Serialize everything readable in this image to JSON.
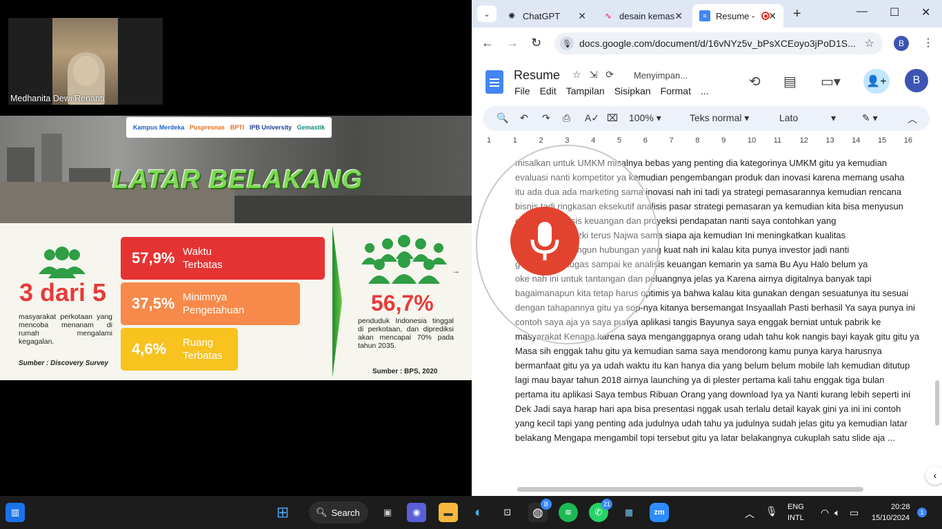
{
  "video": {
    "participant_name": "Medhanita Dewi Renanti"
  },
  "slide": {
    "logos": [
      "Kampus Merdeka",
      "Puspresnas",
      "BPTI",
      "IPB University",
      "Gemastik"
    ],
    "title": "LATAR BELAKANG",
    "left_stat": "3 dari 5",
    "left_desc": "masyarakat perkotaan yang mencoba menanam di rumah mengalami kegagalan.",
    "left_source": "Sumber : Discovery Survey",
    "bars": [
      {
        "pct": "57,9%",
        "label": "Waktu Terbatas"
      },
      {
        "pct": "37,5%",
        "label": "Minimnya Pengetahuan"
      },
      {
        "pct": "4,6%",
        "label": "Ruang Terbatas"
      }
    ],
    "right_stat": "56,7%",
    "right_desc": "penduduk Indonesia tinggal di perkotaan, dan diprediksi akan mencapai 70% pada tahun 2035.",
    "right_source": "Sumber : BPS, 2020",
    "colors": {
      "red": "#e53333",
      "orange": "#f78a4a",
      "yellow": "#f8c21f",
      "green": "#2f9e44"
    }
  },
  "browser": {
    "tabs": [
      {
        "title": "ChatGPT",
        "icon": "chatgpt-icon"
      },
      {
        "title": "desain kemas",
        "icon": "chart-icon"
      },
      {
        "title": "Resume -",
        "icon": "docs-icon"
      }
    ],
    "url": "docs.google.com/document/d/16vNYz5v_bPsXCEoyo3jPoD1S...",
    "profile_initial": "B"
  },
  "docs": {
    "title": "Resume",
    "status": "Menyimpan...",
    "menu": [
      "File",
      "Edit",
      "Tampilan",
      "Sisipkan",
      "Format",
      "..."
    ],
    "account_initial": "B",
    "toolbar": {
      "zoom": "100%",
      "style": "Teks normal",
      "font": "Lato"
    },
    "ruler": [
      "1",
      "1",
      "2",
      "3",
      "4",
      "5",
      "6",
      "7",
      "8",
      "9",
      "10",
      "11",
      "12",
      "13",
      "14",
      "15",
      "16"
    ],
    "lines": [
      "misalkan untuk UMKM misalnya bebas yang penting dia kategorinya UMKM gitu ya kemudian",
      "evaluasi nanti kompetitor ya kemudian pengembangan produk dan inovasi karena memang usaha",
      "itu ada dua ada marketing sama inovasi nah ini tadi ya strategi pemasarannya kemudian rencana",
      "bisnis tadi ringkasan eksekutif analisis pasar strategi pemasaran ya kemudian kita bisa menyusun",
      "e                          erta ini analisis keuangan dan proyeksi pendapatan nanti saya contohkan yang",
      "                         ya Ada siapa Rizki terus Najwa sama siapa aja kemudian Ini meningkatkan kualitas",
      "                          a sama Membangun hubungan yang kuat nah ini kalau kita punya investor jadi nanti",
      "g                         dah belum tugas sampai ke analisis keuangan kemarin ya sama Bu Ayu Halo belum ya",
      "oke nah ini untuk tantangan dan peluangnya jelas ya Karena airnya digitalnya banyak tapi",
      "bagaimanapun kita tetap harus optimis ya bahwa kalau kita gunakan dengan sesuatunya itu sesuai",
      "dengan tahapannya gitu ya sop-nya kitanya bersemangat Insyaallah Pasti berhasil Ya saya punya ini",
      "contoh saya aja ya saya punya aplikasi tangis Bayunya saya enggak berniat untuk pabrik ke",
      "masyarakat Kenapa karena saya menganggapnya orang udah tahu kok nangis bayi kayak gitu gitu ya",
      "Masa sih enggak tahu gitu ya kemudian sama saya mendorong kamu punya karya harusnya",
      "bermanfaat gitu ya ya udah waktu itu kan hanya dia yang belum belum mobile lah kemudian ditutup",
      "lagi mau bayar tahun 2018 airnya launching ya di plester pertama kali tahu enggak tiga bulan",
      "pertama itu aplikasi Saya tembus Ribuan Orang yang download Iya ya Nanti kurang lebih seperti ini",
      "Dek Jadi saya harap hari apa bisa presentasi nggak usah terlalu detail kayak gini ya ini ini contoh",
      "yang kecil tapi yang penting ada judulnya udah tahu ya judulnya sudah jelas gitu ya kemudian latar",
      "belakang Mengapa mengambil topi tersebut gitu ya latar belakangnya cukuplah satu slide aja ..."
    ]
  },
  "taskbar": {
    "search_label": "Search",
    "chrome_badge": "B",
    "whatsapp_badge": "21",
    "lang_top": "ENG",
    "lang_bottom": "INTL",
    "time": "20:28",
    "date": "15/10/2024",
    "notification_count": "1"
  }
}
